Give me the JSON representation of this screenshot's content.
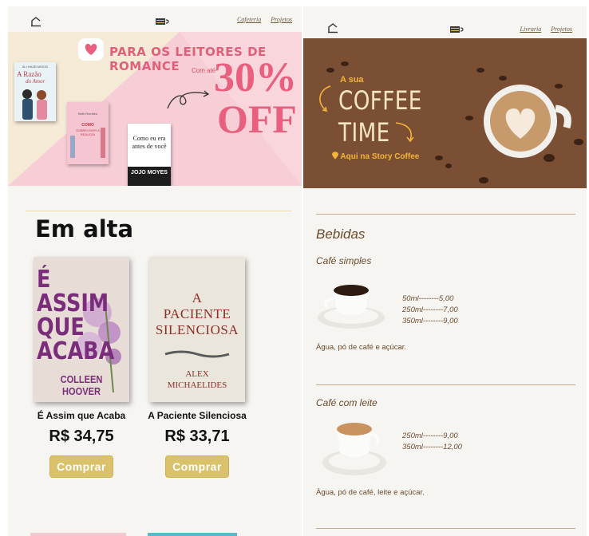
{
  "left_page": {
    "nav": {
      "links": [
        "Cafeteria",
        "Projetos"
      ]
    },
    "banner": {
      "title": "PARA OS LEITORES DE ROMANCE",
      "prefix": "Com até",
      "discount": "30%",
      "off": "OFF",
      "books": [
        {
          "author": "ALI HAZELWOOD",
          "title_a": "A Razão",
          "title_b": "do Amor"
        },
        {
          "author": "Beth Reekles",
          "title_a": "COMO",
          "title_b": "SOBREVIVER À REALEZA"
        },
        {
          "title_a": "Como eu era",
          "title_b": "antes de você",
          "author": "JOJO MOYES"
        }
      ]
    },
    "section_title": "Em alta",
    "products": [
      {
        "name": "É Assim que Acaba",
        "price": "R$ 34,75",
        "buy_label": "Comprar",
        "cover_lines": [
          "É",
          "ASSIM",
          "QUE",
          "ACABA"
        ],
        "cover_author": "COLLEEN HOOVER"
      },
      {
        "name": "A Paciente Silenciosa",
        "price": "R$ 33,71",
        "buy_label": "Comprar",
        "cover_lines": [
          "A",
          "PACIENTE",
          "SILENCIOSA"
        ],
        "cover_author": "ALEX MICHAELIDES"
      }
    ]
  },
  "right_page": {
    "nav": {
      "links": [
        "Livraria",
        "Projetos"
      ]
    },
    "banner": {
      "small": "A sua",
      "line1": "COFFEE",
      "line2": "TIME",
      "place": "Aqui na Story Coffee"
    },
    "menu_title": "Bebidas",
    "items": [
      {
        "name": "Café simples",
        "prices": [
          "50ml--------5,00",
          "250ml--------7,00",
          "350ml--------9,00"
        ],
        "description": "Água, pó de café e açúcar."
      },
      {
        "name": "Café com leite",
        "prices": [
          "250ml--------9,00",
          "350ml--------12,00"
        ],
        "description": "Água, pó de café, leite e açúcar."
      }
    ]
  },
  "colors": {
    "accent_gold": "#d9c26a",
    "romance_pink": "#e9607e",
    "coffee_brown": "#7a4f33",
    "menu_text": "#6b4a2b"
  }
}
